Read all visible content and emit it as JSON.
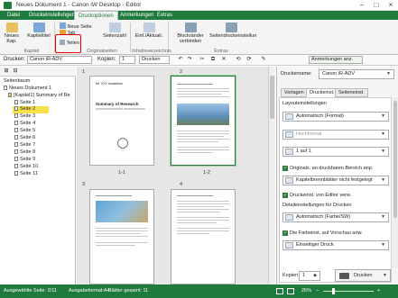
{
  "window": {
    "title": "Neues Dokument 1 - Canon iW Desktop - Editor"
  },
  "tabs": [
    "Datei",
    "Druckeinstellungen",
    "Druckoptionen",
    "Anmerkungen",
    "Extras"
  ],
  "ribbon": {
    "buttons": {
      "new_chapter": "Neues Kap.",
      "chapter_title": "Kapiteltitel",
      "new_page": "Neue Seite",
      "tab": "Tab",
      "divide": "Teilen",
      "page_number": "Seitenzahl",
      "toc": "Einf./Aktuali.",
      "spread": "Blockränder verbinden",
      "copy_pages": "Seitendruckeinstellun"
    },
    "groups": {
      "chapter": "Kapitel",
      "original": "Originalseiten",
      "contents": "Inhaltsverzeichnis",
      "extras": "Extras"
    }
  },
  "toolbar": {
    "printer_label": "Drucken:",
    "printer_value": "Canon iR-ADV",
    "copies_label": "Kopien:",
    "copies_value": "1",
    "print_label": "Drucken",
    "annotations_label": "Anmerkungen anz."
  },
  "left": {
    "header": "Seitenbaum",
    "tree": [
      {
        "label": "Neues Dokument 1",
        "level": 0
      },
      {
        "label": "[Kapitel1] Summary of Re",
        "level": 1
      },
      {
        "label": "Seite 1",
        "level": 2
      },
      {
        "label": "Seite 2",
        "level": 2,
        "selected": true
      },
      {
        "label": "Seite 3",
        "level": 2
      },
      {
        "label": "Seite 4",
        "level": 2
      },
      {
        "label": "Seite 5",
        "level": 2
      },
      {
        "label": "Seite 6",
        "level": 2
      },
      {
        "label": "Seite 7",
        "level": 2
      },
      {
        "label": "Seite 8",
        "level": 2
      },
      {
        "label": "Seite 9",
        "level": 2
      },
      {
        "label": "Seite 10",
        "level": 2
      },
      {
        "label": "Seite 11",
        "level": 2
      }
    ]
  },
  "center": {
    "chapters": [
      "1",
      "2",
      "3",
      "4"
    ],
    "page_captions": [
      "1-1",
      "1-2"
    ],
    "page1": {
      "to": "Mr. XXX Inoaseline",
      "title": "Summary of Research",
      "subtitle": "XXXXXXXXXXXXXXX XXXXXXXXXXXX"
    }
  },
  "right": {
    "printer_label": "Druckername:",
    "printer_value": "Canon iR-ADV",
    "tabs": [
      "Vorlagen",
      "Druckeinst.",
      "Seiteneinst."
    ],
    "layout_header": "Layouteinstellungen",
    "layout_value": "Automatisch (Format)",
    "paper_value": "Hochformat",
    "nup_value": "1 auf 1",
    "originals_check": "Originals. an druckbaren Bereich anp.",
    "chapter_value": "Kapitelbrennblätter nicht festgelegt",
    "print_editor_check": "Druckeinst. von Editor verw.",
    "detail_header": "Detaileinstellungen für Drucken",
    "color_value": "Automatisch (Farbe/SW)",
    "preview_check": "Die Farbeinst. auf Vorschau anw.",
    "duplex_value": "Einseitiger Druck",
    "copies_label": "Kopien",
    "copies_value": "1",
    "print_button": "Drucken"
  },
  "status": {
    "selected": "Ausgewählte Seite: 2/11",
    "paper": "Ausgabeformat:A4",
    "sheets": "Blätter gesamt: 11",
    "zoom": "25%"
  }
}
